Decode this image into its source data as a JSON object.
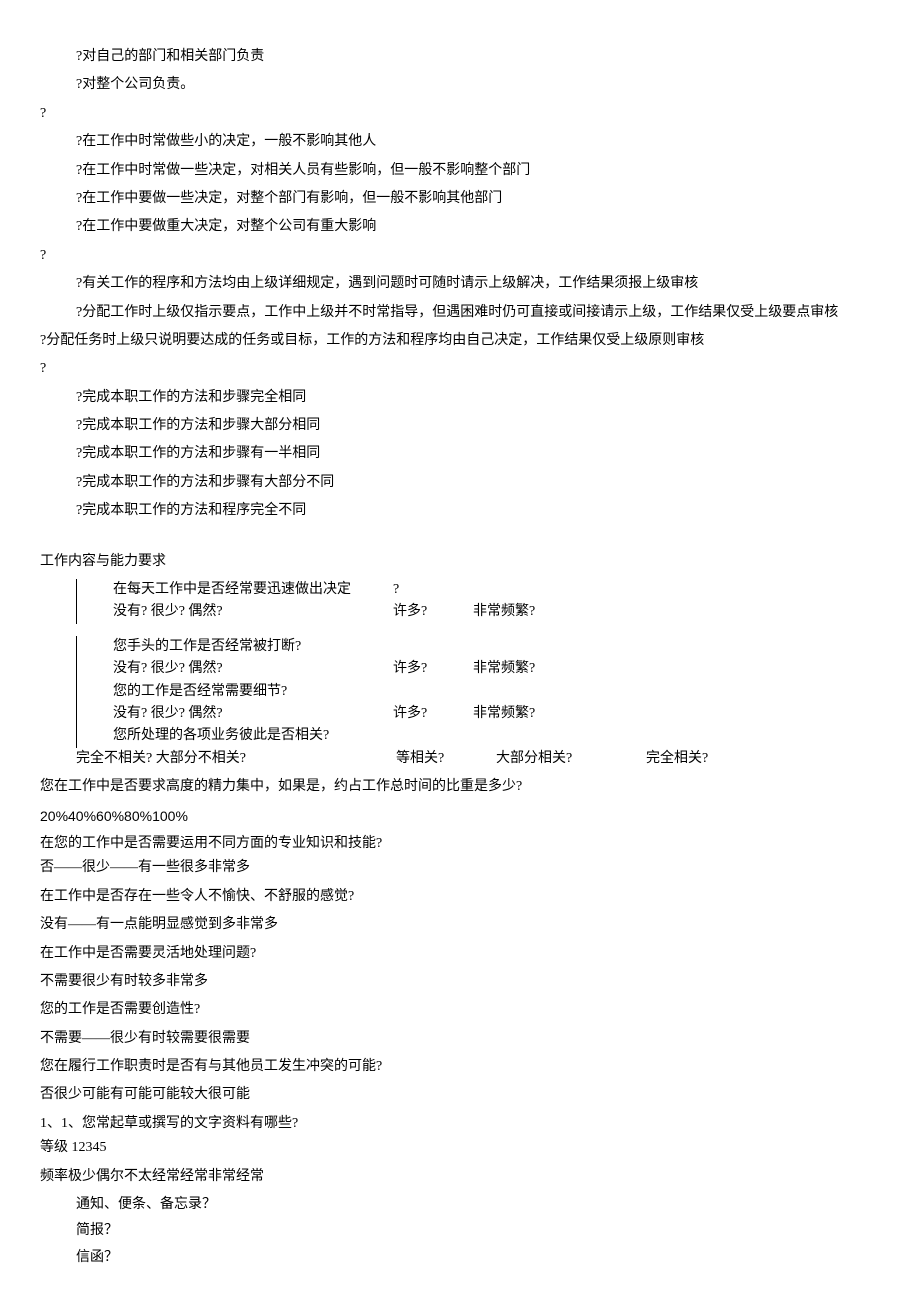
{
  "sec1": {
    "l1": "?对自己的部门和相关部门负责",
    "l2": "?对整个公司负责。"
  },
  "q1": "?",
  "sec2": {
    "l1": "?在工作中时常做些小的决定，一般不影响其他人",
    "l2": "?在工作中时常做一些决定，对相关人员有些影响，但一般不影响整个部门",
    "l3": "?在工作中要做一些决定，对整个部门有影响，但一般不影响其他部门",
    "l4": "?在工作中要做重大决定，对整个公司有重大影响"
  },
  "q2": "?",
  "sec3": {
    "l1": "?有关工作的程序和方法均由上级详细规定，遇到问题时可随时请示上级解决，工作结果须报上级审核",
    "l2": "?分配工作时上级仅指示要点，工作中上级并不时常指导，但遇困难时仍可直接或间接请示上级，工作结果仅受上级要点审核"
  },
  "p_long": "?分配任务时上级只说明要达成的任务或目标，工作的方法和程序均由自己决定，工作结果仅受上级原则审核",
  "q3": "?",
  "sec4": {
    "l1": "?完成本职工作的方法和步骤完全相同",
    "l2": "?完成本职工作的方法和步骤大部分相同",
    "l3": "?完成本职工作的方法和步骤有一半相同",
    "l4": "?完成本职工作的方法和步骤有大部分不同",
    "l5": "?完成本职工作的方法和程序完全不同"
  },
  "workheading": "工作内容与能力要求",
  "grid": {
    "r1a": "在每天工作中是否经常要迅速做出决定",
    "r1b": "?",
    "r2a": "没有? 很少? 偶然?",
    "r2b": "许多?",
    "r2c": "非常频繁?",
    "r3": "您手头的工作是否经常被打断?",
    "r4a": "没有? 很少? 偶然?",
    "r4b": "许多?",
    "r4c": "非常频繁?",
    "r5": "您的工作是否经常需要细节?",
    "r6a": "没有? 很少? 偶然?",
    "r6b": "许多?",
    "r6c": "非常频繁?",
    "r7": "您所处理的各项业务彼此是否相关?"
  },
  "related": {
    "c1": "完全不相关? 大部分不相关?",
    "c2": "等相关?",
    "c3": "大部分相关?",
    "c4": "完全相关?"
  },
  "qs": {
    "q1": "您在工作中是否要求高度的精力集中，如果是，约占工作总时间的比重是多少?",
    "a1": "20%40%60%80%100%",
    "q2": "在您的工作中是否需要运用不同方面的专业知识和技能?",
    "a2": "否——很少——有一些很多非常多",
    "q3": "在工作中是否存在一些令人不愉快、不舒服的感觉?",
    "a3": "没有——有一点能明显感觉到多非常多",
    "q4": "在工作中是否需要灵活地处理问题?",
    "a4": "不需要很少有时较多非常多",
    "q5": "您的工作是否需要创造性?",
    "a5": "不需要——很少有时较需要很需要",
    "q6": "您在履行工作职责时是否有与其他员工发生冲突的可能?",
    "a6": "否很少可能有可能可能较大很可能",
    "q7": "1、1、您常起草或撰写的文字资料有哪些?",
    "a7": "等级 12345",
    "q8": "频率极少偶尔不太经常经常非常经常"
  },
  "docs": {
    "d1": "通知、便条、备忘录？",
    "d2": "简报？",
    "d3": "信函？"
  }
}
